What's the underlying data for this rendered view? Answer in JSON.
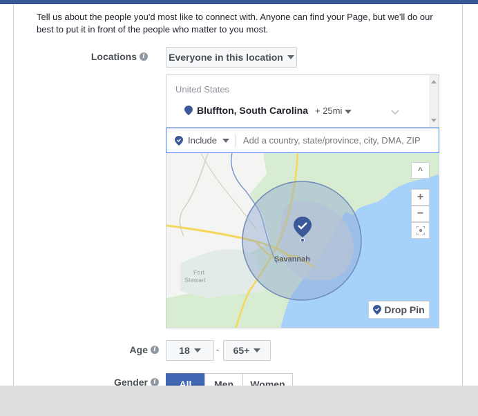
{
  "intro_text": "Tell us about the people you'd most like to connect with. Anyone can find your Page, but we'll do our best to put it in front of the people who matter to you most.",
  "locations": {
    "label": "Locations",
    "audience_dropdown": "Everyone in this location",
    "country": "United States",
    "selected_location": "Bluffton, South Carolina",
    "radius": "+ 25mi",
    "include_dropdown": "Include",
    "search_placeholder": "Add a country, state/province, city, DMA, ZIP"
  },
  "map": {
    "city_label": "Savannah",
    "area_label_line1": "Fort",
    "area_label_line2": "Stewart",
    "drop_pin_label": "Drop Pin",
    "zoom_in": "+",
    "zoom_out": "−",
    "collapse": "^"
  },
  "age": {
    "label": "Age",
    "min": "18",
    "separator": "-",
    "max": "65+"
  },
  "gender": {
    "label": "Gender",
    "options": [
      "All",
      "Men",
      "Women"
    ],
    "selected": "All"
  },
  "colors": {
    "brand": "#3b5998",
    "active": "#4267b2",
    "pin": "#3b5998"
  }
}
